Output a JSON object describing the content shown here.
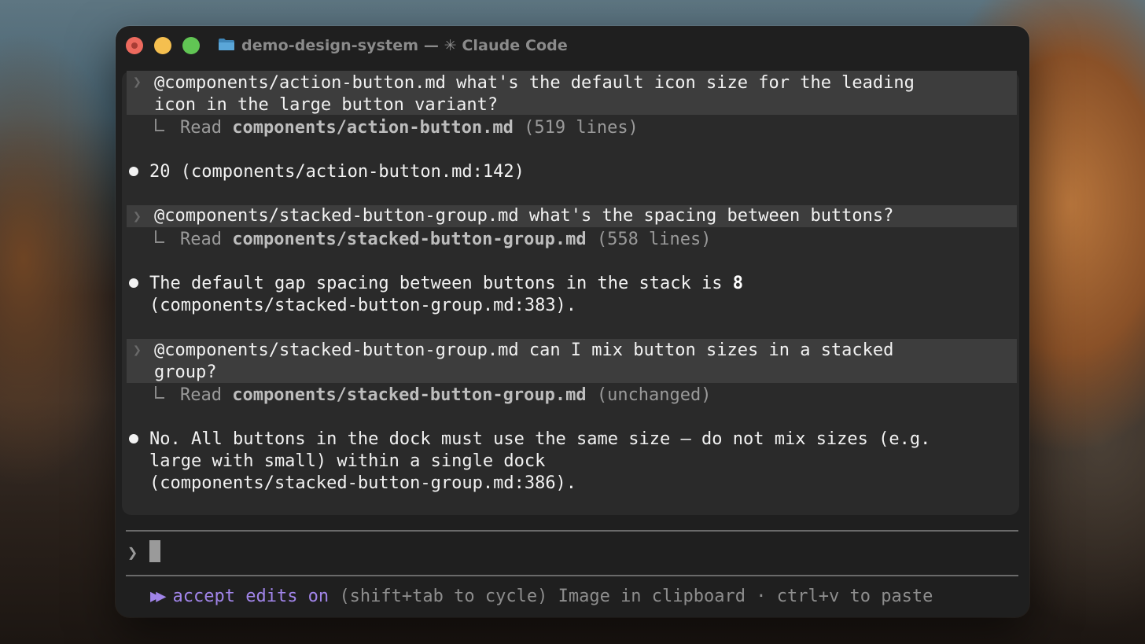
{
  "window": {
    "title": "demo-design-system — ✳ Claude Code"
  },
  "conversation": [
    {
      "prompt_lines": [
        "@components/action-button.md what's the default icon size for the leading",
        "icon in the large button variant?"
      ],
      "read_label": "Read",
      "read_file": "components/action-button.md",
      "read_meta": "(519 lines)",
      "answer_lines": [
        "20 (components/action-button.md:142)"
      ]
    },
    {
      "prompt_lines": [
        "@components/stacked-button-group.md what's the spacing between buttons?"
      ],
      "read_label": "Read",
      "read_file": "components/stacked-button-group.md",
      "read_meta": "(558 lines)",
      "answer_prefix": "The default gap spacing between buttons in the stack is ",
      "answer_bold": "8",
      "answer_line2": "(components/stacked-button-group.md:383)."
    },
    {
      "prompt_lines": [
        "@components/stacked-button-group.md can I mix button sizes in a stacked",
        "group?"
      ],
      "read_label": "Read",
      "read_file": "components/stacked-button-group.md",
      "read_meta": "(unchanged)",
      "answer_lines": [
        "No. All buttons in the dock must use the same size — do not mix sizes (e.g.",
        "large with small) within a single dock",
        "(components/stacked-button-group.md:386)."
      ]
    }
  ],
  "input": {
    "prompt_symbol": "❯",
    "value": ""
  },
  "status_bar": {
    "mode_icon": "▶▶",
    "mode_label": "accept edits on",
    "mode_hint": "(shift+tab to cycle)",
    "clipboard_text": "Image in clipboard · ctrl+v to paste"
  },
  "colors": {
    "accent": "#a084e8",
    "panel": "#2a2a2a",
    "window": "#1f1f1f"
  },
  "icons": {
    "titlebar": "folder-icon",
    "prompt": "chevron-right-icon",
    "answer": "bullet-icon"
  }
}
